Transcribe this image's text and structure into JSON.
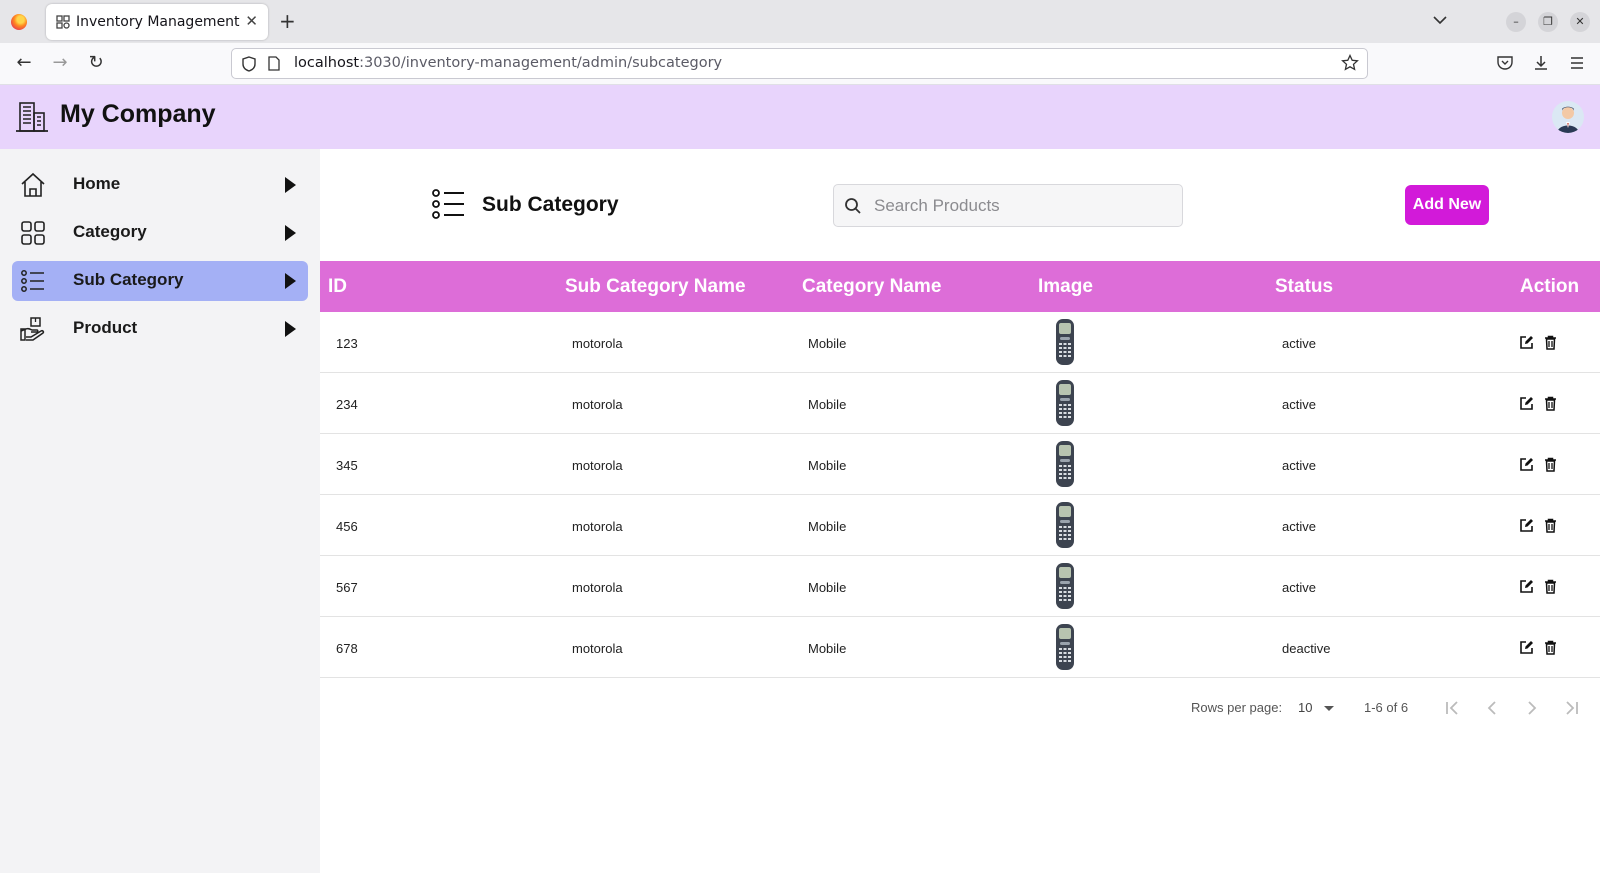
{
  "browser": {
    "tab_title": "Inventory Management",
    "url_host": "localhost",
    "url_path": ":3030/inventory-management/admin/subcategory"
  },
  "app": {
    "brand": "My Company"
  },
  "sidebar": {
    "items": [
      {
        "label": "Home",
        "active": false
      },
      {
        "label": "Category",
        "active": false
      },
      {
        "label": "Sub Category",
        "active": true
      },
      {
        "label": "Product",
        "active": false
      }
    ]
  },
  "page": {
    "title": "Sub Category",
    "search_placeholder": "Search Products",
    "add_label": "Add New"
  },
  "table": {
    "headers": [
      "ID",
      "Sub Category Name",
      "Category Name",
      "Image",
      "Status",
      "Action"
    ],
    "rows": [
      {
        "id": "123",
        "sub": "motorola",
        "cat": "Mobile",
        "status": "active"
      },
      {
        "id": "234",
        "sub": "motorola",
        "cat": "Mobile",
        "status": "active"
      },
      {
        "id": "345",
        "sub": "motorola",
        "cat": "Mobile",
        "status": "active"
      },
      {
        "id": "456",
        "sub": "motorola",
        "cat": "Mobile",
        "status": "active"
      },
      {
        "id": "567",
        "sub": "motorola",
        "cat": "Mobile",
        "status": "active"
      },
      {
        "id": "678",
        "sub": "motorola",
        "cat": "Mobile",
        "status": "deactive"
      }
    ]
  },
  "pagination": {
    "rows_label": "Rows per page:",
    "rows_value": "10",
    "range": "1-6 of 6"
  },
  "colors": {
    "header_bg": "#e8d4fc",
    "table_head": "#dd6dd8",
    "add_button": "#d21ad9",
    "active_nav": "#a4b0f5"
  }
}
